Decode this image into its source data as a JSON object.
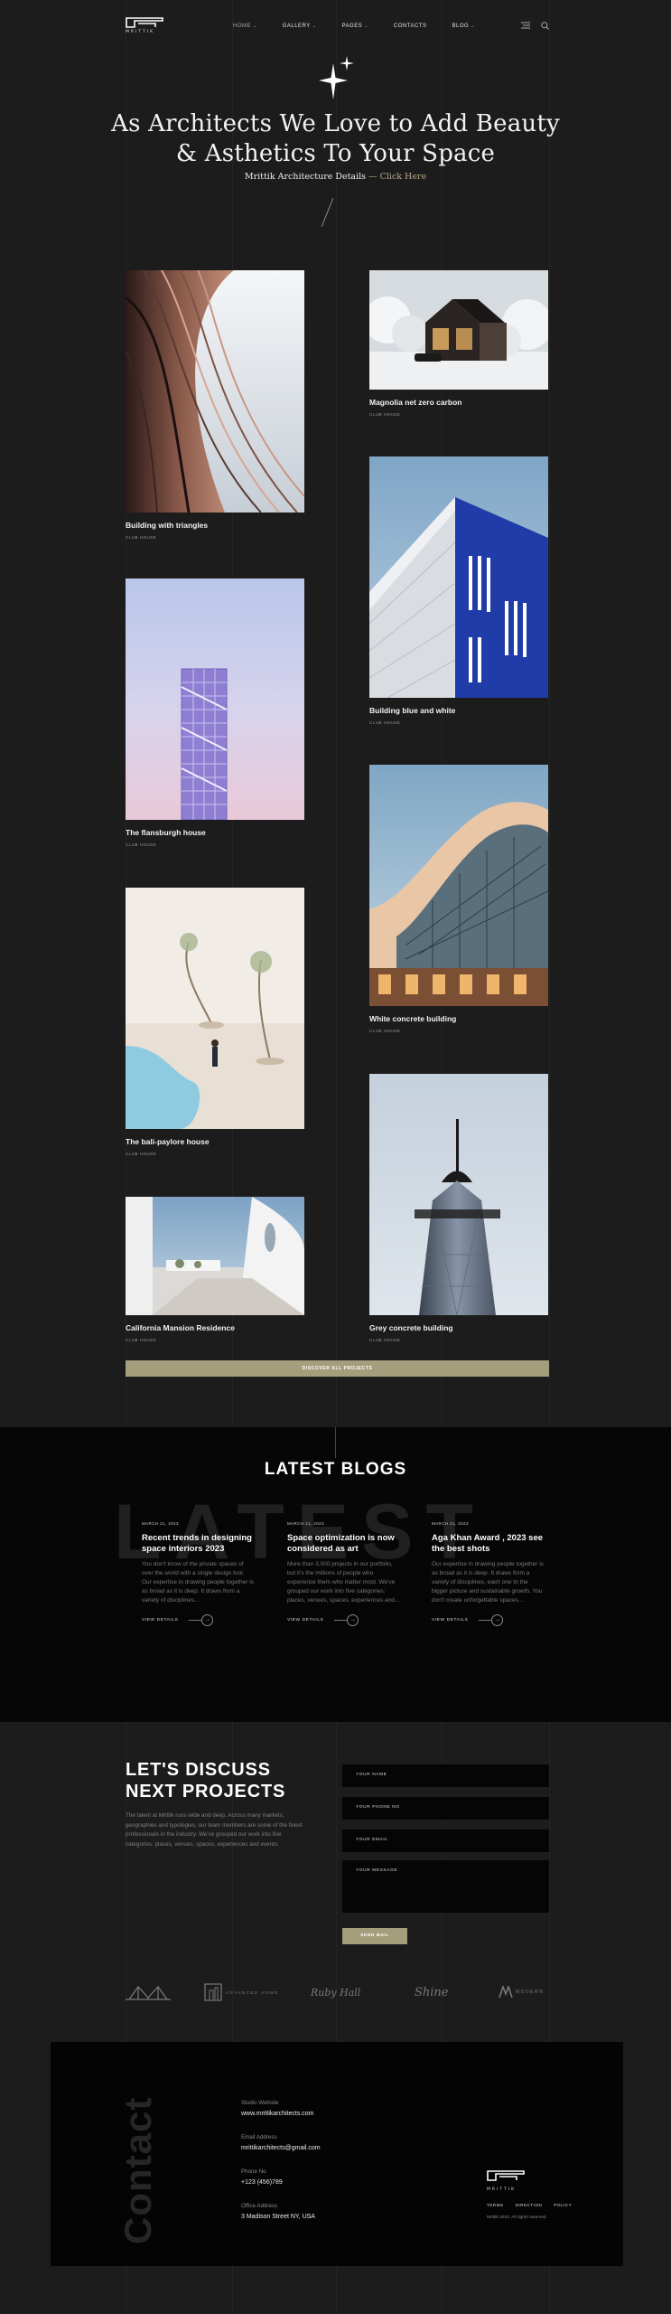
{
  "header": {
    "logo_text": "MRITTIK",
    "nav": [
      {
        "label": "HOME",
        "has_menu": true
      },
      {
        "label": "GALLERY",
        "has_menu": true
      },
      {
        "label": "PAGES",
        "has_menu": true
      },
      {
        "label": "CONTACTS",
        "has_menu": false
      },
      {
        "label": "BLOG",
        "has_menu": true
      }
    ],
    "chevron": "⌄",
    "menu_icon": "hamburger-icon",
    "search_icon": "search-icon"
  },
  "hero": {
    "title_line1": "As Architects We Love to Add Beauty",
    "title_line2": "& Asthetics To Your Space",
    "sub_text": "Mrittik Architecture Details",
    "sub_link": "— Click Here"
  },
  "projects": [
    {
      "title": "Building with triangles",
      "category": "CLUB HOUSE"
    },
    {
      "title": "Magnolia net zero carbon",
      "category": "CLUB HOUSE"
    },
    {
      "title": "Building blue and white",
      "category": "CLUB HOUSE"
    },
    {
      "title": "The flansburgh house",
      "category": "CLUB HOUSE"
    },
    {
      "title": "White concrete building",
      "category": "CLUB HOUSE"
    },
    {
      "title": "The bali-paylore house",
      "category": "CLUB HOUSE"
    },
    {
      "title": "California Mansion Residence",
      "category": "CLUB HOUSE"
    },
    {
      "title": "Grey concrete building",
      "category": "CLUB HOUSE"
    }
  ],
  "discover_label": "DISCOVER ALL PROJECTS",
  "blogs": {
    "title": "LATEST BLOGS",
    "bg_word": "LATEST",
    "more_label": "VIEW DETAILS",
    "arrow": "→",
    "items": [
      {
        "date": "MARCH 21, 2023",
        "title": "Recent trends in designing space interiors 2023",
        "excerpt": "You don't know of the private spaces of over the world with a single design tool. Our expertise in drawing people together is as broad as it is deep. It draws from a variety of disciplines..."
      },
      {
        "date": "MARCH 21, 2023",
        "title": "Space optimization is now considered as art",
        "excerpt": "More than 3,000 projects in our portfolio, but it's the millions of people who experience them who matter most. We've grouped our work into five categories: places, venues, spaces, experiences and..."
      },
      {
        "date": "MARCH 21, 2023",
        "title": "Aga Khan Award , 2023 see the best shots",
        "excerpt": "Our expertise in drawing people together is as broad as it is deep. It draws from a variety of disciplines, each one to the bigger picture and sustainable growth. You don't create unforgettable spaces..."
      }
    ]
  },
  "discuss": {
    "title_line1": "LET'S DISCUSS",
    "title_line2": "NEXT PROJECTS",
    "text": "The talent at Mrittik runs wide and deep. Across many markets, geographies and typologies, our team members are some of the finest professionals in the industry. We've grouped our work into five categories: places, venues, spaces, experiences and events.",
    "fields": [
      "YOUR NAME",
      "YOUR PHONE NO",
      "YOUR EMAIL",
      "YOUR MESSAGE"
    ],
    "send_label": "SEND MAIL"
  },
  "partners": [
    {
      "name": "bridge-logo",
      "text": ""
    },
    {
      "name": "building-logo",
      "text": "ADVANCED HOME"
    },
    {
      "name": "signature-logo",
      "text": "Ruby Hall"
    },
    {
      "name": "script-logo",
      "text": "Shine"
    },
    {
      "name": "mw-logo",
      "text": "MODERN"
    }
  ],
  "contact": {
    "vertical_word": "Contact",
    "items": [
      {
        "label": "Studio Website",
        "value": "www.mrittikarchitects.com"
      },
      {
        "label": "Email Address",
        "value": "mrittikarchitects@gmail.com"
      },
      {
        "label": "Phone No",
        "value": "+123 (456)789"
      },
      {
        "label": "Office Address",
        "value": "3 Madison Street NY, USA"
      }
    ],
    "logo_text": "MRITTIK",
    "footer_nav": [
      "TERMS",
      "DIRECTION",
      "POLICY"
    ],
    "copyright": "Mrittik 2023. All rights reserved"
  },
  "colors": {
    "background": "#1c1c1c",
    "accent": "#a59e7c",
    "dark_section": "#060606",
    "link": "#b7aa83"
  }
}
